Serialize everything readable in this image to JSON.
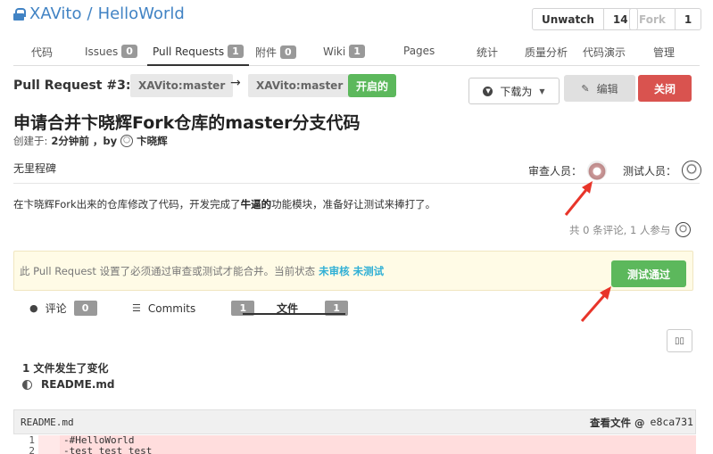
{
  "repo": {
    "owner": "XAVito",
    "name": "HelloWorld",
    "separator": " / "
  },
  "header_buttons": {
    "unwatch_label": "Unwatch",
    "unwatch_count": "14",
    "fork_label": "Fork",
    "fork_count": "1"
  },
  "tabs": [
    {
      "label": "代码",
      "badge": ""
    },
    {
      "label": "Issues",
      "badge": "0"
    },
    {
      "label": "Pull Requests",
      "badge": "1"
    },
    {
      "label": "附件",
      "badge": "0"
    },
    {
      "label": "Wiki",
      "badge": "1"
    },
    {
      "label": "Pages",
      "badge": ""
    },
    {
      "label": "统计",
      "badge": ""
    },
    {
      "label": "质量分析",
      "badge": ""
    },
    {
      "label": "代码演示",
      "badge": ""
    },
    {
      "label": "管理",
      "badge": ""
    }
  ],
  "pr": {
    "number_label": "Pull Request #3:",
    "source_branch": "XAVito:master",
    "arrow": "→",
    "target_branch": "XAVito:master",
    "status": "开启的",
    "title": "申请合并卞晓辉Fork仓库的master分支代码",
    "created_prefix": "创建于:",
    "created_time": "2分钟前",
    "created_by": "，by",
    "author": "卞晓辉",
    "milestone": "无里程碑",
    "reviewers_label": "审查人员：",
    "testers_label": "测试人员：",
    "description_before": "在卞晓辉Fork出来的仓库修改了代码，开发完成了",
    "description_bold": "牛逼的",
    "description_after": "功能模块，准备好让测试来捧打了。",
    "comment_summary": "共 0 条评论, 1 人参与"
  },
  "actions": {
    "download": "下载为",
    "edit": "编辑",
    "close": "关闭"
  },
  "notice": {
    "text": "此 Pull Request 设置了必须通过审查或测试才能合并。当前状态",
    "status1": "未审核",
    "status2": "未测试",
    "button": "测试通过"
  },
  "sub_tabs": [
    {
      "label": "评论",
      "count": "0"
    },
    {
      "label": "Commits",
      "count": "1"
    },
    {
      "label": "文件",
      "count": "1"
    }
  ],
  "files": {
    "summary": "1 文件发生了变化",
    "items": [
      "README.md"
    ]
  },
  "diff": {
    "filename": "README.md",
    "view_label": "查看文件 @",
    "commit": "e8ca731",
    "lines": [
      {
        "num": "1",
        "code": "-#HelloWorld"
      },
      {
        "num": "2",
        "code": "-test test test"
      }
    ]
  },
  "colors": {
    "link": "#4183c4",
    "green": "#5cb85c",
    "red": "#d9534f",
    "annotation_arrow": "#e8352a"
  }
}
